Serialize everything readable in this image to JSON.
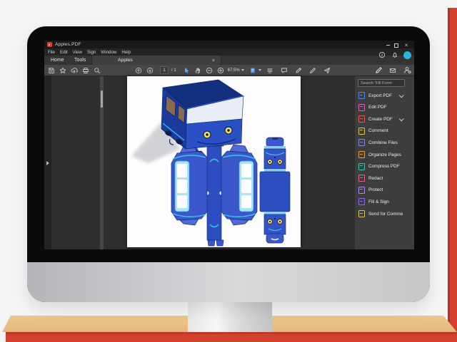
{
  "window": {
    "title": "Apples.PDF",
    "close_glyph": "×"
  },
  "menu": {
    "items": [
      "File",
      "Edit",
      "View",
      "Sign",
      "Window",
      "Help"
    ]
  },
  "tabs": {
    "home": "Home",
    "tools": "Tools",
    "document": "Apples",
    "doc_close": "×"
  },
  "toolbar": {
    "page_number": "1",
    "page_total": "/ 1",
    "zoom": "67.5%"
  },
  "panel": {
    "search_placeholder": "Search 'Fill Form'",
    "items": [
      {
        "label": "Export PDF",
        "color": "#4a8cf5",
        "chevron": true
      },
      {
        "label": "Edit PDF",
        "color": "#e05fc0",
        "chevron": false
      },
      {
        "label": "Create PDF",
        "color": "#ee5a4f",
        "chevron": true
      },
      {
        "label": "Comment",
        "color": "#e3c94f",
        "chevron": false
      },
      {
        "label": "Combine Files",
        "color": "#8f8af0",
        "chevron": false
      },
      {
        "label": "Organize Pages",
        "color": "#e8a23e",
        "chevron": false
      },
      {
        "label": "Compress PDF",
        "color": "#37c7b2",
        "chevron": false
      },
      {
        "label": "Redact",
        "color": "#ef6292",
        "chevron": false
      },
      {
        "label": "Protect",
        "color": "#a78df2",
        "chevron": false
      },
      {
        "label": "Fill & Sign",
        "color": "#8f6bee",
        "chevron": false
      },
      {
        "label": "Send for Comme",
        "color": "#dfc25a",
        "chevron": false
      }
    ]
  },
  "document_art": {
    "description": "3D blue papercraft bus with yellow eyes above its flattened die-cut template",
    "bus_blue": "#2b4fc4",
    "bus_navy": "#132f80",
    "eye_yellow": "#f3e34c",
    "template_blue": "#3a58cc",
    "template_light_blue": "#7fd2f2"
  },
  "colors": {
    "accent_red": "#d2402e",
    "desk_tan": "#ebc58e",
    "avatar_cyan": "#2ab5dd",
    "app_dark": "#2e2e2e",
    "toolbar_gray": "#464646",
    "panel_gray": "#3d3d3d"
  },
  "icons": {
    "toolbar_left": [
      "save",
      "star",
      "cloud-upload",
      "print",
      "search"
    ],
    "toolbar_center": [
      "page-up",
      "page-down",
      "select-cursor",
      "hand-tool",
      "zoom-out",
      "zoom-in",
      "page-view",
      "scroll-mode",
      "comment",
      "pencil",
      "sign",
      "send"
    ],
    "toolbar_right": [
      "fill-sign-pen",
      "envelope",
      "person-gear"
    ],
    "top_right": [
      "info",
      "bell",
      "avatar"
    ]
  }
}
